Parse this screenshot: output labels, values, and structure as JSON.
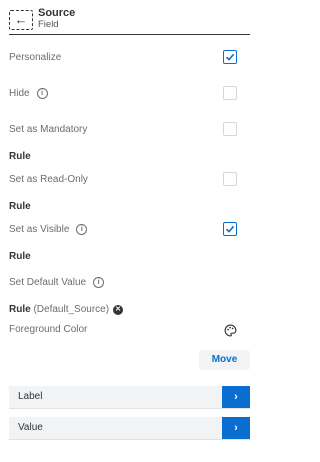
{
  "header": {
    "back_icon": "←",
    "title": "Source",
    "subtitle": "Field"
  },
  "fields": {
    "personalize": {
      "label": "Personalize",
      "checked": true
    },
    "hide": {
      "label": "Hide",
      "checked": false
    },
    "set_as_mandatory": {
      "label": "Set as Mandatory",
      "checked": false
    },
    "mandatory_rule": "Rule",
    "set_as_read_only": {
      "label": "Set as Read-Only",
      "checked": false
    },
    "read_only_rule": "Rule",
    "set_as_visible": {
      "label": "Set as Visible",
      "checked": true
    },
    "visible_rule": "Rule",
    "set_default_value": {
      "label": "Set Default Value"
    },
    "default_rule": {
      "label": "Rule",
      "value": "(Default_Source)"
    },
    "foreground_color": {
      "label": "Foreground Color",
      "icon": "palette-icon"
    }
  },
  "info_icon": "i",
  "clear_icon": "✕",
  "move_button": "Move",
  "sections": [
    {
      "label": "Label",
      "button": "›"
    },
    {
      "label": "Value",
      "button": "›"
    }
  ],
  "colors": {
    "accent": "#0a6ed1",
    "text": "#32363a",
    "muted": "#6a6d70",
    "bar_bg": "#f1f3f5"
  }
}
